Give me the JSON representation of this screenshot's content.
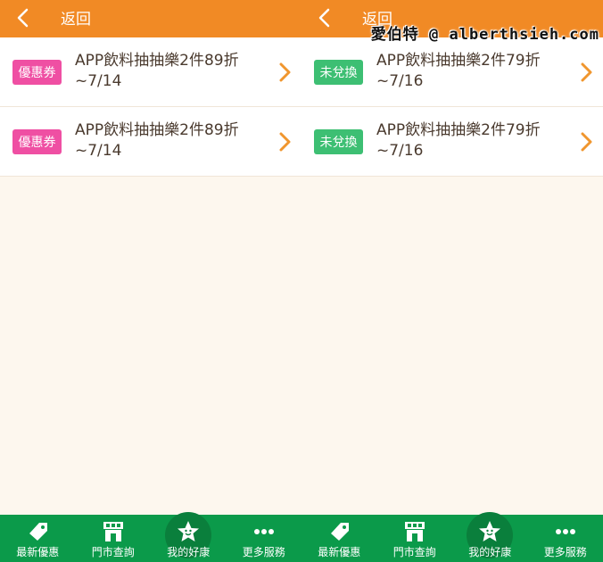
{
  "watermark": "愛伯特 @ alberthsieh.com",
  "colors": {
    "header": "#f18a25",
    "bottom_nav": "#0b9a4a",
    "badge_coupon": "#ef4fa3",
    "badge_unredeemed": "#3dbf73",
    "chevron": "#f0962e"
  },
  "left": {
    "back_label": "返回",
    "items": [
      {
        "badge": "優惠券",
        "title": "APP飲料抽抽樂2件89折~7/14"
      },
      {
        "badge": "優惠券",
        "title": "APP飲料抽抽樂2件89折~7/14"
      }
    ],
    "nav": [
      {
        "icon": "tag-icon",
        "label": "最新優惠"
      },
      {
        "icon": "store-icon",
        "label": "門市查詢"
      },
      {
        "icon": "star-smile-icon",
        "label": "我的好康"
      },
      {
        "icon": "more-dots-icon",
        "label": "更多服務"
      }
    ]
  },
  "right": {
    "back_label": "返回",
    "items": [
      {
        "badge": "未兌換",
        "title": "APP飲料抽抽樂2件79折~7/16"
      },
      {
        "badge": "未兌換",
        "title": "APP飲料抽抽樂2件79折~7/16"
      }
    ],
    "nav": [
      {
        "icon": "tag-icon",
        "label": "最新優惠"
      },
      {
        "icon": "store-icon",
        "label": "門市查詢"
      },
      {
        "icon": "star-smile-icon",
        "label": "我的好康"
      },
      {
        "icon": "more-dots-icon",
        "label": "更多服務"
      }
    ]
  }
}
